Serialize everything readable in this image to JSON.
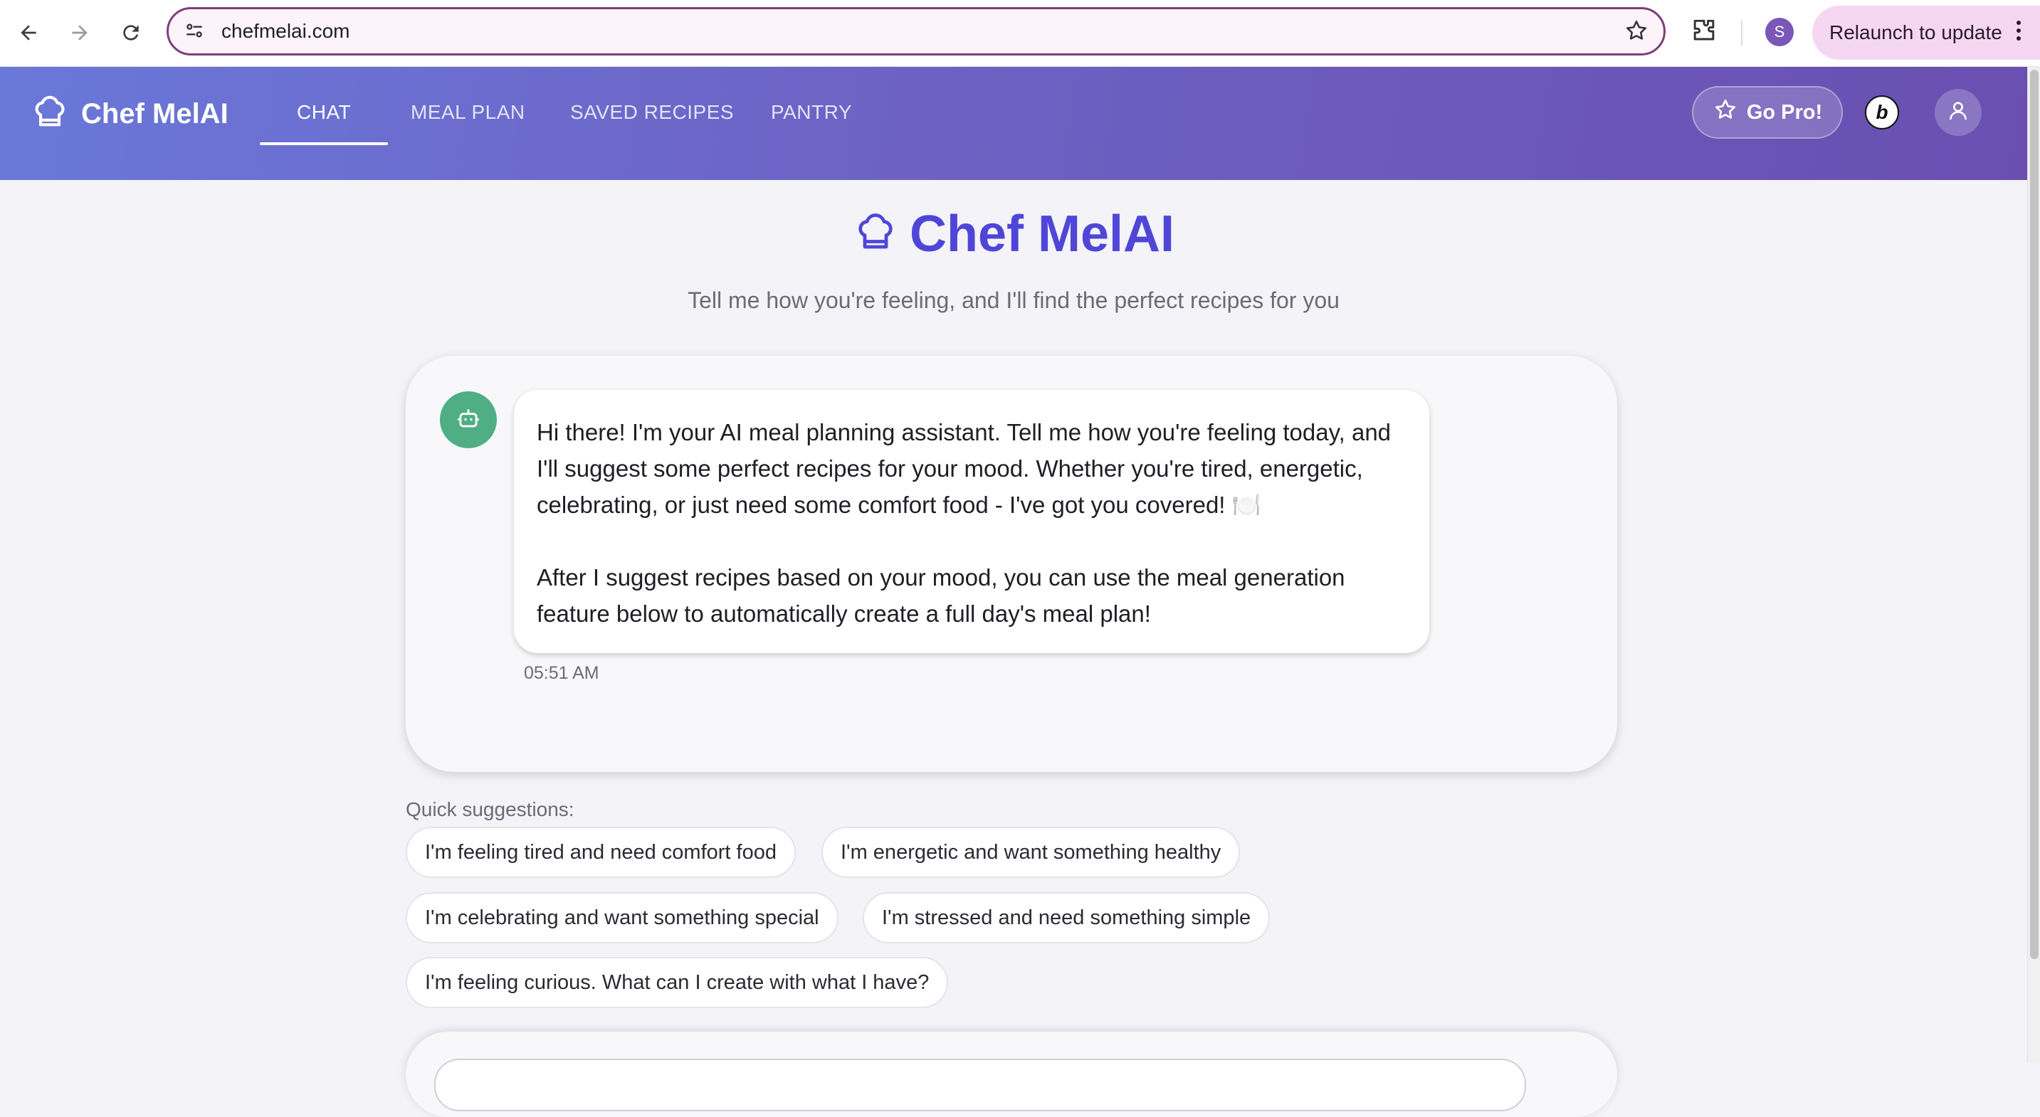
{
  "browser": {
    "url": "chefmelai.com",
    "profile_initial": "S",
    "relaunch_label": "Relaunch to update"
  },
  "header": {
    "brand": "Chef MelAI",
    "tabs": [
      {
        "label": "CHAT",
        "active": true
      },
      {
        "label": "MEAL PLAN",
        "active": false
      },
      {
        "label": "SAVED RECIPES",
        "active": false
      },
      {
        "label": "PANTRY",
        "active": false
      }
    ],
    "go_pro_label": "Go Pro!",
    "b_logo_letter": "b"
  },
  "main": {
    "title": "Chef MelAI",
    "subtitle": "Tell me how you're feeling, and I'll find the perfect recipes for you",
    "message": {
      "paragraph1": "Hi there! I'm your AI meal planning assistant. Tell me how you're feeling today, and I'll suggest some perfect recipes for your mood. Whether you're tired, energetic, celebrating, or just need some comfort food - I've got you covered! 🍽️",
      "paragraph2": "After I suggest recipes based on your mood, you can use the meal generation feature below to automatically create a full day's meal plan!",
      "timestamp": "05:51 AM"
    },
    "quick_suggestions_label": "Quick suggestions:",
    "suggestions": [
      "I'm feeling tired and need comfort food",
      "I'm energetic and want something healthy",
      "I'm celebrating and want something special",
      "I'm stressed and need something simple",
      "I'm feeling curious. What can I create with what I have?"
    ]
  },
  "colors": {
    "header_gradient_start": "#6a78d9",
    "header_gradient_end": "#6a4fb0",
    "title_accent": "#4f46d8",
    "bot_avatar": "#4fae84",
    "omnibox_border": "#7b3f7c"
  },
  "icons": [
    "back-icon",
    "forward-icon",
    "reload-icon",
    "site-info-icon",
    "bookmark-star-icon",
    "extensions-icon",
    "chef-hat-icon",
    "star-icon",
    "user-icon",
    "robot-icon",
    "more-vert-icon"
  ]
}
